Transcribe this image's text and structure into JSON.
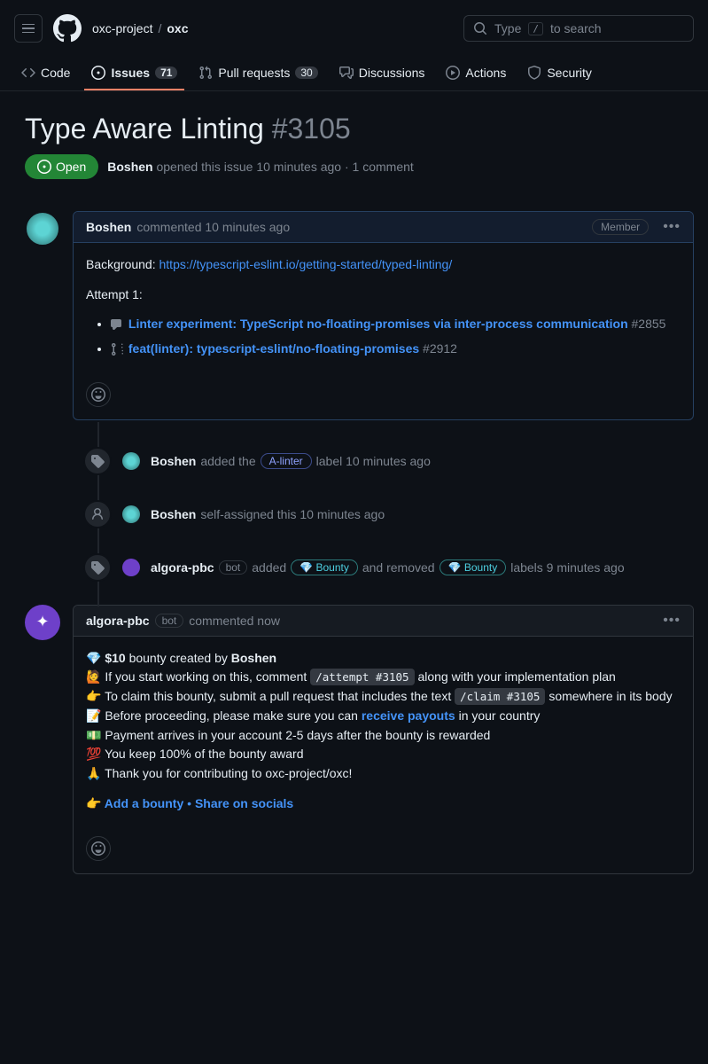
{
  "header": {
    "owner": "oxc-project",
    "repo": "oxc",
    "search_placeholder": "Type",
    "search_suffix": "to search",
    "search_key": "/"
  },
  "tabs": {
    "code": "Code",
    "issues": "Issues",
    "issues_count": "71",
    "pulls": "Pull requests",
    "pulls_count": "30",
    "discussions": "Discussions",
    "actions": "Actions",
    "security": "Security"
  },
  "issue": {
    "title": "Type Aware Linting",
    "number": "#3105",
    "status": "Open",
    "author": "Boshen",
    "opened_text": "opened this issue 10 minutes ago",
    "comment_count": "1 comment"
  },
  "comment1": {
    "author": "Boshen",
    "time": "commented 10 minutes ago",
    "badge": "Member",
    "background_label": "Background:",
    "background_link": "https://typescript-eslint.io/getting-started/typed-linting/",
    "attempt_label": "Attempt 1:",
    "ref1_text": "Linter experiment: TypeScript no-floating-promises via inter-process communication",
    "ref1_num": "#2855",
    "ref2_text": "feat(linter): typescript-eslint/no-floating-promises",
    "ref2_num": "#2912"
  },
  "timeline": {
    "t1_author": "Boshen",
    "t1_action": "added the",
    "t1_label": "A-linter",
    "t1_suffix": "label 10 minutes ago",
    "t2_author": "Boshen",
    "t2_text": "self-assigned this 10 minutes ago",
    "t3_author": "algora-pbc",
    "t3_bot": "bot",
    "t3_added": "added",
    "t3_bounty": "💎 Bounty",
    "t3_removed": "and removed",
    "t3_suffix": "labels 9 minutes ago"
  },
  "comment2": {
    "author": "algora-pbc",
    "bot": "bot",
    "time": "commented now",
    "line1_prefix": "💎",
    "line1_amount": "$10",
    "line1_mid": "bounty created by",
    "line1_by": "Boshen",
    "line2_prefix": "🙋 If you start working on this, comment",
    "line2_code": "/attempt #3105",
    "line2_suffix": "along with your implementation plan",
    "line3_prefix": "👉 To claim this bounty, submit a pull request that includes the text",
    "line3_code": "/claim #3105",
    "line3_suffix": "somewhere in its body",
    "line4_prefix": "📝 Before proceeding, please make sure you can",
    "line4_link": "receive payouts",
    "line4_suffix": "in your country",
    "line5": "💵 Payment arrives in your account 2-5 days after the bounty is rewarded",
    "line6": "💯 You keep 100% of the bounty award",
    "line7": "🙏 Thank you for contributing to oxc-project/oxc!",
    "action1": "👉 Add a bounty",
    "action_sep": "•",
    "action2": "Share on socials"
  }
}
